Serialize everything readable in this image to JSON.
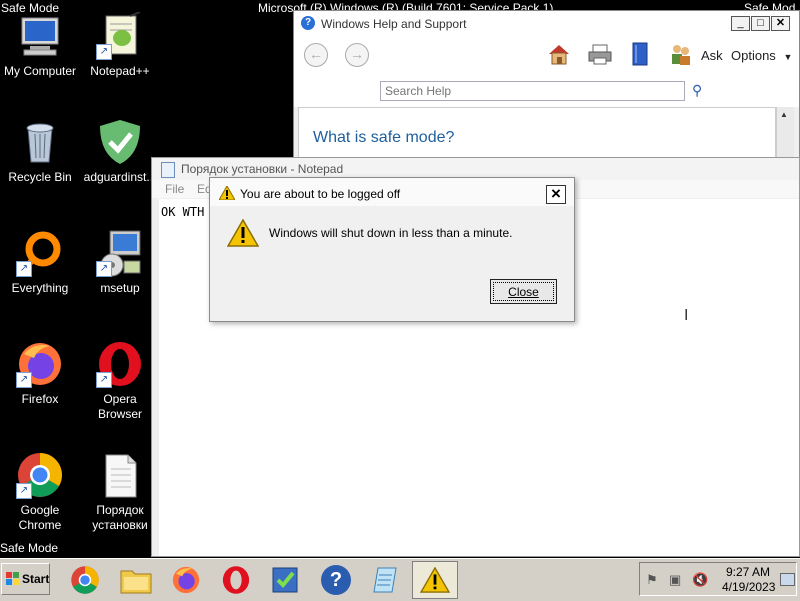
{
  "desktop": {
    "safe_mode_tl": "Safe Mode",
    "safe_mode_tr": "Safe Mod",
    "safe_mode_bl": "Safe Mode",
    "top_center_text": "Microsoft (R) Windows (R) (Build 7601: Service Pack 1)",
    "icons": {
      "my_computer": "My Computer",
      "notepadpp": "Notepad++",
      "recycle_bin": "Recycle Bin",
      "adguard": "adguardinst...",
      "everything": "Everything",
      "msetup": "msetup",
      "firefox": "Firefox",
      "opera_line1": "Opera",
      "opera_line2": "Browser",
      "chrome_line1": "Google",
      "chrome_line2": "Chrome",
      "order_line1": "Порядок",
      "order_line2": "установки"
    }
  },
  "help_window": {
    "title": "Windows Help and Support",
    "ask": "Ask",
    "options": "Options",
    "search_placeholder": "Search Help",
    "heading": "What is safe mode?"
  },
  "notepad": {
    "title": "Порядок установки - Notepad",
    "menu_file": "File",
    "menu_edit": "Ed",
    "content": "OK WTH"
  },
  "dialog": {
    "title": "You are about to be logged off",
    "message": "Windows will shut down in less than a minute.",
    "close_button": "Close",
    "close_x": "×"
  },
  "taskbar": {
    "start": "Start",
    "time": "9:27 AM",
    "date": "4/19/2023"
  },
  "colors": {
    "accent": "#1d4fa3",
    "help_link": "#1e5e9e"
  }
}
